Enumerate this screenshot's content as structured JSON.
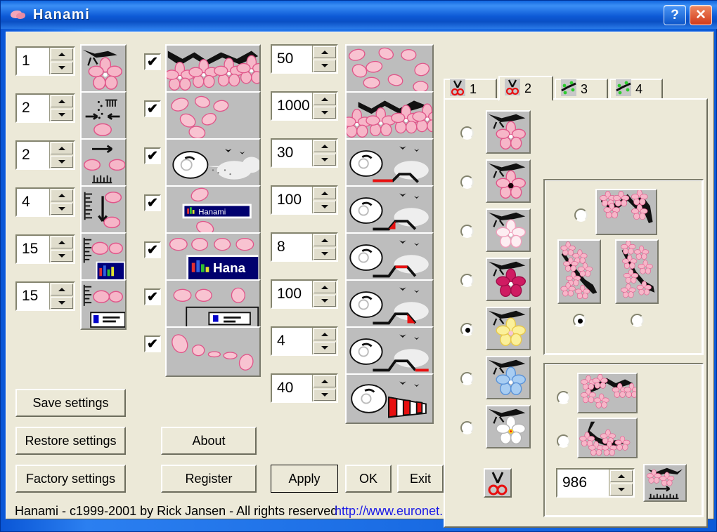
{
  "window": {
    "title": "Hanami",
    "icon": "petal-icon",
    "help_label": "?",
    "close_label": "✕",
    "titlebar_color": "#0a56d6",
    "client_color": "#ece9d8"
  },
  "left_panel": {
    "spinners_col1": [
      {
        "name": "spinner-blossom-size",
        "value": "1"
      },
      {
        "name": "spinner-sway-amount",
        "value": "2"
      },
      {
        "name": "spinner-horizontal-speed",
        "value": "2"
      },
      {
        "name": "spinner-fall-speed",
        "value": "4"
      },
      {
        "name": "spinner-taskbar-offset",
        "value": "15"
      },
      {
        "name": "spinner-tray-offset",
        "value": "15"
      }
    ],
    "checkboxes": [
      {
        "name": "checkbox-blossoms-on-branch",
        "checked": true,
        "mark": "✔"
      },
      {
        "name": "checkbox-falling-petals",
        "checked": true,
        "mark": "✔"
      },
      {
        "name": "checkbox-wind-clouds",
        "checked": true,
        "mark": "✔"
      },
      {
        "name": "checkbox-petals-over-titlebar",
        "checked": true,
        "mark": "✔"
      },
      {
        "name": "checkbox-petals-over-taskbar",
        "checked": true,
        "mark": "✔"
      },
      {
        "name": "checkbox-petals-over-tray",
        "checked": true,
        "mark": "✔"
      },
      {
        "name": "checkbox-petal-trail",
        "checked": true,
        "mark": "✔"
      }
    ],
    "spinners_col3": [
      {
        "name": "spinner-petal-count",
        "value": "50"
      },
      {
        "name": "spinner-max-petals",
        "value": "1000"
      },
      {
        "name": "spinner-wind-frequency",
        "value": "30"
      },
      {
        "name": "spinner-wind-duration",
        "value": "100"
      },
      {
        "name": "spinner-wind-rampup",
        "value": "8"
      },
      {
        "name": "spinner-wind-strength",
        "value": "100"
      },
      {
        "name": "spinner-wind-rampdown",
        "value": "4"
      },
      {
        "name": "spinner-gust-strength",
        "value": "40"
      }
    ],
    "buttons": [
      {
        "name": "save-settings-button",
        "label": "Save settings"
      },
      {
        "name": "restore-settings-button",
        "label": "Restore settings"
      },
      {
        "name": "factory-settings-button",
        "label": "Factory settings"
      },
      {
        "name": "about-button",
        "label": "About"
      },
      {
        "name": "register-button",
        "label": "Register"
      },
      {
        "name": "apply-button",
        "label": "Apply"
      },
      {
        "name": "ok-button",
        "label": "OK"
      },
      {
        "name": "exit-button",
        "label": "Exit"
      }
    ]
  },
  "tabs": [
    {
      "name": "tab-1",
      "label": "1",
      "icon": "scissors-icon",
      "selected": false
    },
    {
      "name": "tab-2",
      "label": "2",
      "icon": "scissors-icon",
      "selected": true
    },
    {
      "name": "tab-3",
      "label": "3",
      "icon": "branch-bud-icon",
      "selected": false
    },
    {
      "name": "tab-4",
      "label": "4",
      "icon": "branch-bud-icon",
      "selected": false
    }
  ],
  "tab_panel": {
    "flower_options": [
      {
        "name": "flower-option-pink",
        "color": "#f6b6c8",
        "center": "#ffffff",
        "selected": false
      },
      {
        "name": "flower-option-pink-dark-center",
        "color": "#f7b9ca",
        "center": "#1a0008",
        "selected": false
      },
      {
        "name": "flower-option-white-pink",
        "color": "#fdeef2",
        "center": "#ffffff",
        "selected": false
      },
      {
        "name": "flower-option-magenta",
        "color": "#cf1b62",
        "center": "#ffffff",
        "selected": false
      },
      {
        "name": "flower-option-yellow",
        "color": "#fbf09a",
        "center": "#f8c7d4",
        "selected": true
      },
      {
        "name": "flower-option-blue",
        "color": "#a8cdf2",
        "center": "#ffffff",
        "selected": false
      },
      {
        "name": "flower-option-white",
        "color": "#ffffff",
        "center": "#ffd21e",
        "selected": false
      }
    ],
    "branch_group": {
      "name": "branch-style-group",
      "options": [
        {
          "name": "branch-option-top",
          "selected": false
        },
        {
          "name": "branch-option-bottom-left",
          "selected": true
        },
        {
          "name": "branch-option-bottom-right",
          "selected": false
        }
      ]
    },
    "horizontal_group": {
      "name": "horizontal-branch-group",
      "options": [
        {
          "name": "horizontal-branch-option-1",
          "selected": false
        },
        {
          "name": "horizontal-branch-option-2",
          "selected": false
        }
      ],
      "spinner": {
        "name": "spinner-branch-seed",
        "value": "986"
      },
      "preview_icon": "branch-ruler-icon"
    },
    "scissors_button": {
      "name": "scissors-button",
      "icon": "scissors-icon"
    }
  },
  "footer": {
    "copyright": "Hanami -  c1999-2001 by Rick Jansen - All rights reserved",
    "url": "http://www.euronet.nl/~rja/Hanami",
    "link_color": "#1a1ae6"
  }
}
